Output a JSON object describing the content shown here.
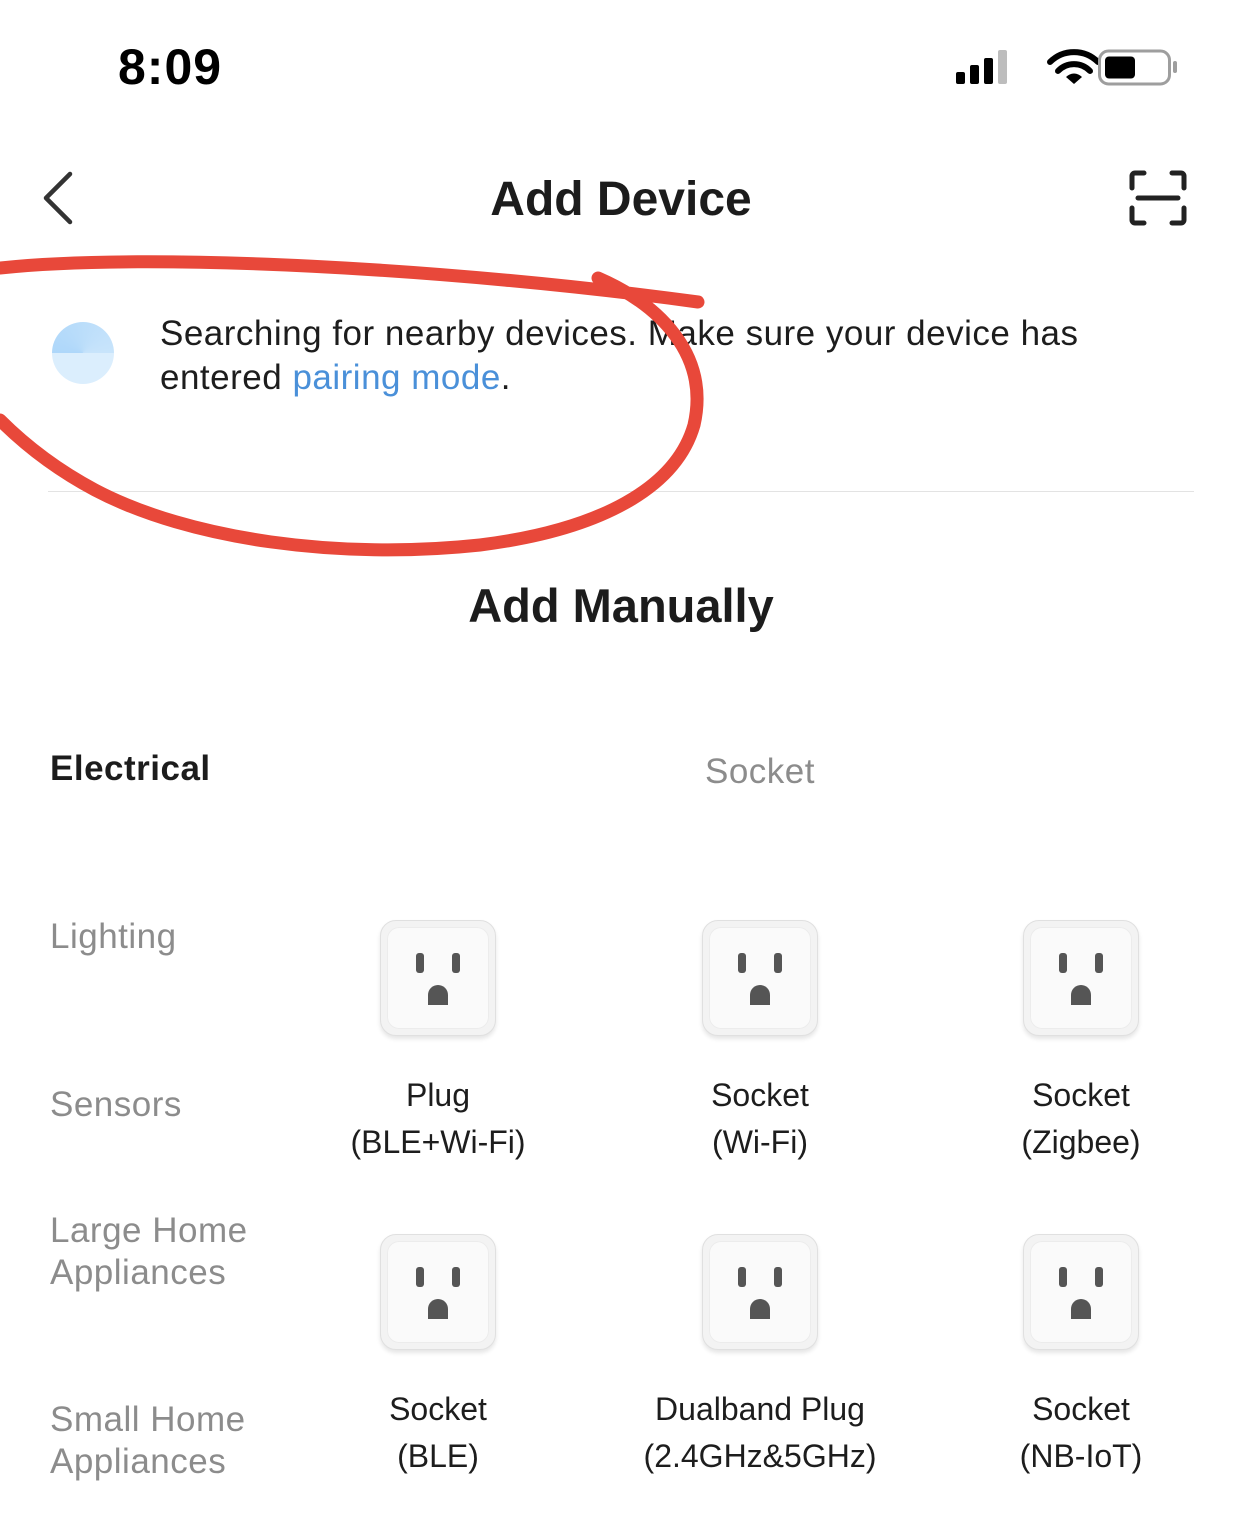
{
  "status_bar": {
    "time": "8:09"
  },
  "header": {
    "title": "Add Device"
  },
  "search": {
    "text_before": "Searching for nearby devices. Make sure your device has entered ",
    "link": "pairing mode",
    "text_after": "."
  },
  "add_manually": {
    "title": "Add Manually"
  },
  "categories": [
    {
      "label": "Electrical",
      "active": true
    },
    {
      "label": "Lighting",
      "active": false
    },
    {
      "label": "Sensors",
      "active": false
    },
    {
      "label": "Large Home Appliances",
      "active": false
    },
    {
      "label": "Small Home Appliances",
      "active": false
    }
  ],
  "subcategory": {
    "title": "Socket"
  },
  "devices": [
    {
      "line1": "Plug",
      "line2": "(BLE+Wi-Fi)",
      "icon": "outlet-icon"
    },
    {
      "line1": "Socket",
      "line2": "(Wi-Fi)",
      "icon": "outlet-icon"
    },
    {
      "line1": "Socket",
      "line2": "(Zigbee)",
      "icon": "outlet-icon"
    },
    {
      "line1": "Socket",
      "line2": "(BLE)",
      "icon": "outlet-icon"
    },
    {
      "line1": "Dualband Plug",
      "line2": "(2.4GHz&5GHz)",
      "icon": "outlet-icon"
    },
    {
      "line1": "Socket",
      "line2": "(NB-IoT)",
      "icon": "outlet-icon"
    }
  ],
  "colors": {
    "link": "#4a90d9",
    "annotation": "#e8483a",
    "muted": "#8c8c8c"
  }
}
